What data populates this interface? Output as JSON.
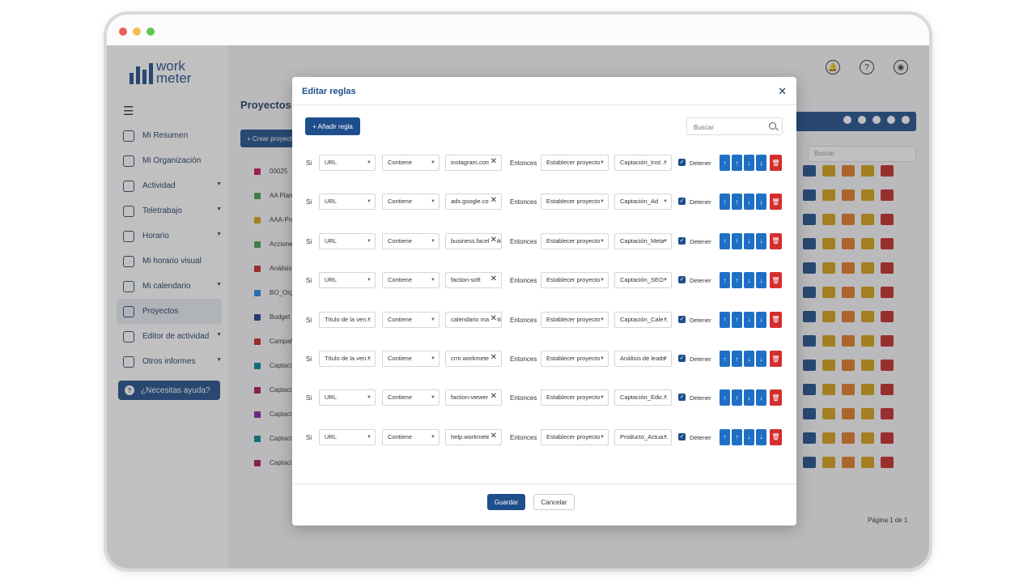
{
  "window": {
    "dot_colors": [
      "#ec5f57",
      "#f4bf4f",
      "#62c654"
    ]
  },
  "brand": {
    "logo_line1": "work",
    "logo_line2": "meter"
  },
  "sidebar": {
    "items": [
      {
        "label": "Mi Resumen",
        "chevron": false
      },
      {
        "label": "Mi Organización",
        "chevron": false
      },
      {
        "label": "Actividad",
        "chevron": true
      },
      {
        "label": "Teletrabajo",
        "chevron": true
      },
      {
        "label": "Horario",
        "chevron": true
      },
      {
        "label": "Mi horario visual",
        "chevron": false
      },
      {
        "label": "Mi calendario",
        "chevron": true
      },
      {
        "label": "Proyectos",
        "chevron": false
      },
      {
        "label": "Editor de actividad",
        "chevron": true
      },
      {
        "label": "Otros informes",
        "chevron": true
      }
    ],
    "active_index": 7,
    "help_label": "¿Necesitas ayuda?"
  },
  "background": {
    "page_title": "Proyectos",
    "create_label": "+ Crear proyecto",
    "search_placeholder": "Buscar",
    "pagination": "Página 1 de 1",
    "projects": [
      {
        "name": "00025",
        "color": "#c2185b"
      },
      {
        "name": "AA Plan",
        "color": "#43a047"
      },
      {
        "name": "AAA-Pro",
        "color": "#d4a017"
      },
      {
        "name": "Acciones",
        "color": "#43a047"
      },
      {
        "name": "Análisis",
        "color": "#c62828"
      },
      {
        "name": "BO_Org",
        "color": "#1e88e5"
      },
      {
        "name": "Budget",
        "color": "#1a3a8a"
      },
      {
        "name": "Campañ",
        "color": "#c62828"
      },
      {
        "name": "Captaci",
        "color": "#00838f"
      },
      {
        "name": "Captaci",
        "color": "#ad1457"
      },
      {
        "name": "Captaci",
        "color": "#7b1fa2"
      },
      {
        "name": "Captaci",
        "color": "#00838f"
      },
      {
        "name": "Captaci",
        "color": "#ad1457"
      }
    ]
  },
  "modal": {
    "title": "Editar reglas",
    "add_rule_label": "+ Añadir regla",
    "search_placeholder": "Buscar",
    "save_label": "Guardar",
    "cancel_label": "Cancelar",
    "rules": [
      {
        "if": "Si",
        "field": "URL",
        "operator": "Contiene",
        "value": "instagram.com",
        "then": "Entonces",
        "action": "Establecer proyecto",
        "target": "Captación_Inst...",
        "stop": "Detener",
        "stop_checked": true
      },
      {
        "if": "Si",
        "field": "URL",
        "operator": "Contiene",
        "value": "ads.google.com",
        "then": "Entonces",
        "action": "Establecer proyecto",
        "target": "Captación_Ad",
        "stop": "Detener",
        "stop_checked": true
      },
      {
        "if": "Si",
        "field": "URL",
        "operator": "Contiene",
        "value": "business.facebook.com",
        "then": "Entonces",
        "action": "Establecer proyecto",
        "target": "Captación_Meta",
        "stop": "Detener",
        "stop_checked": true
      },
      {
        "if": "Si",
        "field": "URL",
        "operator": "Contiene",
        "value": "faction-soft",
        "then": "Entonces",
        "action": "Establecer proyecto",
        "target": "Captación_SEO",
        "stop": "Detener",
        "stop_checked": true
      },
      {
        "if": "Si",
        "field": "Título de la ven...",
        "operator": "Contiene",
        "value": "calendario marketing",
        "then": "Entonces",
        "action": "Establecer proyecto",
        "target": "Captación_Cale...",
        "stop": "Detener",
        "stop_checked": true
      },
      {
        "if": "Si",
        "field": "Título de la ven...",
        "operator": "Contiene",
        "value": "crm.workmeter",
        "then": "Entonces",
        "action": "Establecer proyecto",
        "target": "Análisis de leads",
        "stop": "Detener",
        "stop_checked": true
      },
      {
        "if": "Si",
        "field": "URL",
        "operator": "Contiene",
        "value": "faction-viewer",
        "then": "Entonces",
        "action": "Establecer proyecto",
        "target": "Captación_Edic...",
        "stop": "Detener",
        "stop_checked": true
      },
      {
        "if": "Si",
        "field": "URL",
        "operator": "Contiene",
        "value": "help.workmeter",
        "then": "Entonces",
        "action": "Establecer proyecto",
        "target": "Producto_Actua...",
        "stop": "Detener",
        "stop_checked": true
      }
    ]
  },
  "colors": {
    "primary": "#1f4e8c",
    "arrow_blue": "#1f6fc4",
    "delete_red": "#d32f2f",
    "action_yellow": "#d4a017",
    "action_orange": "#e07b24"
  }
}
